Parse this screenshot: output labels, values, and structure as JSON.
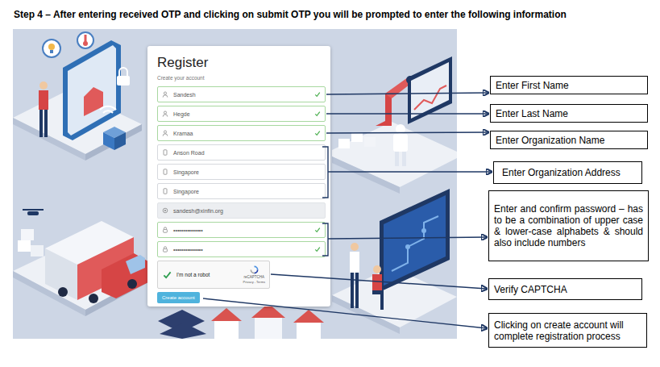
{
  "heading": "Step 4 – After entering received OTP and clicking on submit OTP you will be prompted to enter the following information",
  "form": {
    "title": "Register",
    "subtitle": "Create your account",
    "fields": [
      {
        "kind": "name",
        "value": "Sandesh",
        "valid": true,
        "disabled": false
      },
      {
        "kind": "name",
        "value": "Hegde",
        "valid": true,
        "disabled": false
      },
      {
        "kind": "name",
        "value": "Kramaa",
        "valid": true,
        "disabled": false
      },
      {
        "kind": "address",
        "value": "Anson Road",
        "valid": false,
        "disabled": false
      },
      {
        "kind": "address",
        "value": "Singapore",
        "valid": false,
        "disabled": false
      },
      {
        "kind": "address",
        "value": "Singapore",
        "valid": false,
        "disabled": false
      },
      {
        "kind": "email",
        "value": "sandesh@xinfin.org",
        "valid": false,
        "disabled": true
      },
      {
        "kind": "password",
        "value": "•••••••••••••••",
        "valid": true,
        "disabled": false
      },
      {
        "kind": "password",
        "value": "•••••••••••••••",
        "valid": true,
        "disabled": false
      }
    ],
    "captcha": {
      "label": "I'm not a robot",
      "checked": true,
      "brand": "reCAPTCHA",
      "links": "Privacy - Terms"
    },
    "submit": "Create account"
  },
  "callouts": [
    "Enter First Name",
    "Enter Last Name",
    "Enter Organization Name",
    "Enter Organization Address",
    "Enter and confirm password – has to be a combination of upper case & lower-case alphabets & should also include numbers",
    "Verify CAPTCHA",
    "Clicking on create account will complete registration process"
  ]
}
